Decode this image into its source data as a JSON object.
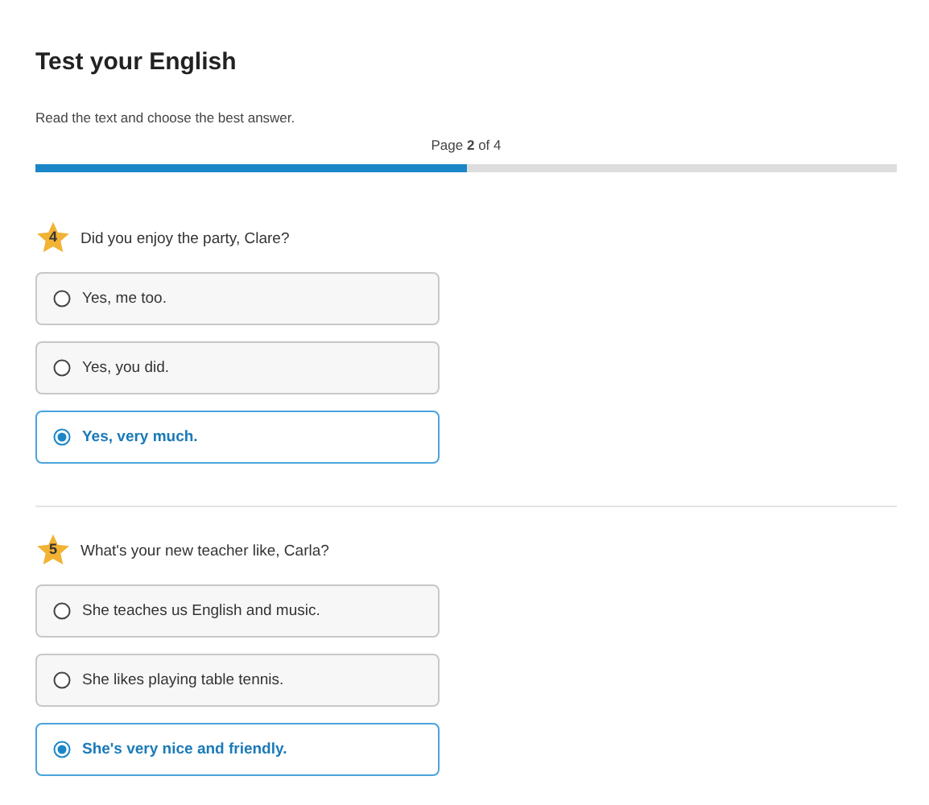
{
  "title": "Test your English",
  "instruction": "Read the text and choose the best answer.",
  "progress": {
    "label": "Page **2** of 4",
    "level": 0.5
  },
  "questions": [
    {
      "number": "4",
      "text": "Did you enjoy the party, Clare?",
      "options": [
        {
          "label": "Yes, me too.",
          "selected": false
        },
        {
          "label": "Yes, you did.",
          "selected": false
        },
        {
          "label": "Yes, very much.",
          "selected": true
        }
      ]
    },
    {
      "number": "5",
      "text": "What's your new teacher like, Carla?",
      "options": [
        {
          "label": "She teaches us English and music.",
          "selected": false
        },
        {
          "label": "She likes playing table tennis.",
          "selected": false
        },
        {
          "label": "She's very nice and friendly.",
          "selected": true
        }
      ]
    }
  ]
}
